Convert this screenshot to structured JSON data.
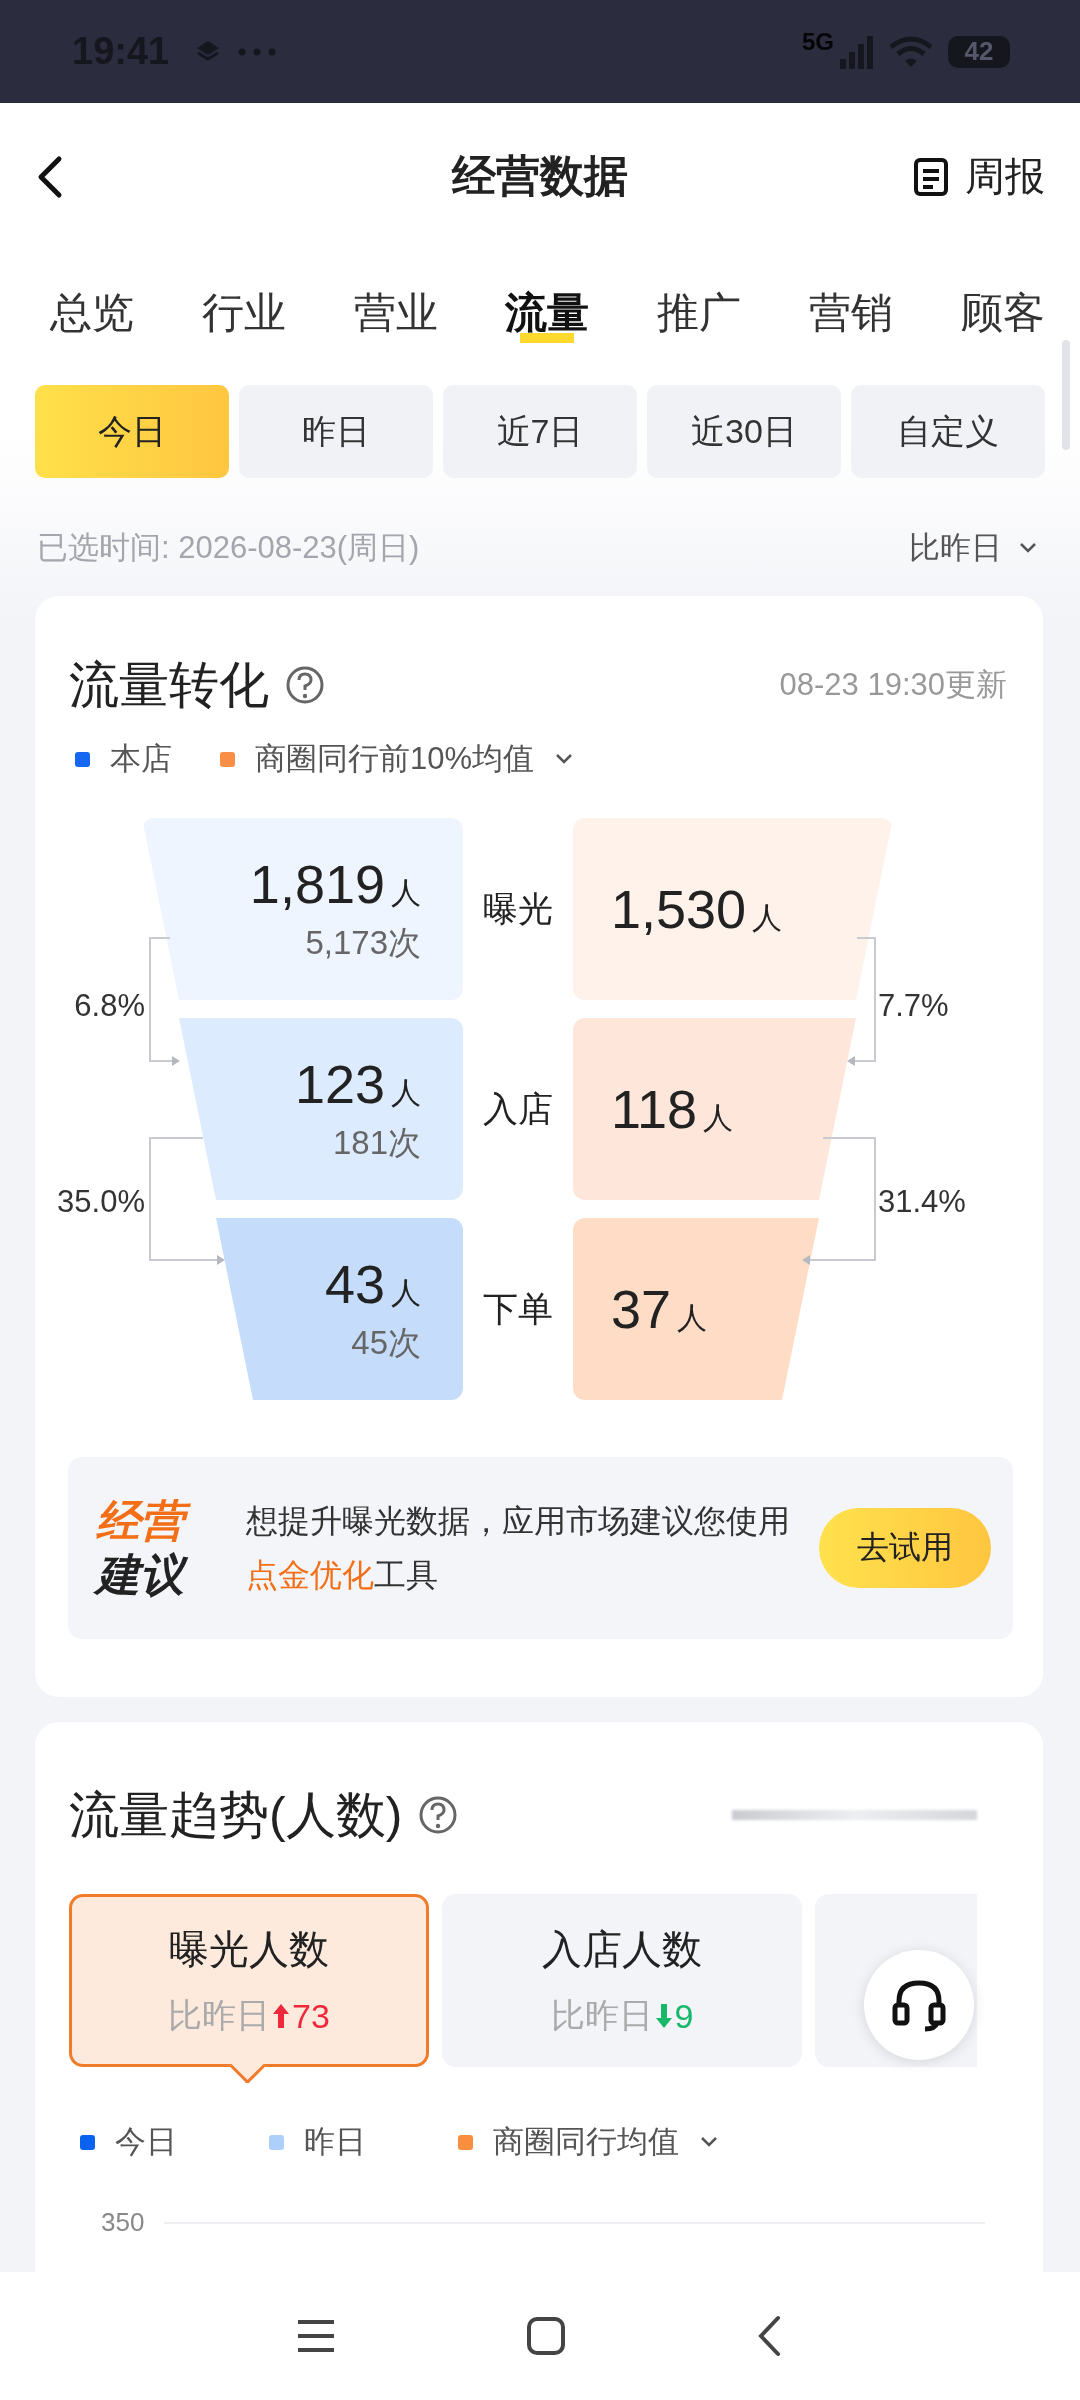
{
  "status_bar": {
    "time": "19:41",
    "network": "5G",
    "battery": "42"
  },
  "header": {
    "title": "经营数据",
    "action": "周报"
  },
  "tabs": [
    {
      "label": "总览",
      "selected": false
    },
    {
      "label": "行业",
      "selected": false
    },
    {
      "label": "营业",
      "selected": false
    },
    {
      "label": "流量",
      "selected": true
    },
    {
      "label": "推广",
      "selected": false
    },
    {
      "label": "营销",
      "selected": false
    },
    {
      "label": "顾客",
      "selected": false
    }
  ],
  "date_ranges": [
    {
      "label": "今日",
      "selected": true
    },
    {
      "label": "昨日",
      "selected": false
    },
    {
      "label": "近7日",
      "selected": false
    },
    {
      "label": "近30日",
      "selected": false
    },
    {
      "label": "自定义",
      "selected": false
    }
  ],
  "selected_time": "已选时间: 2026-08-23(周日)",
  "compare": "比昨日",
  "conversion": {
    "title": "流量转化",
    "updated": "08-23 19:30更新",
    "legend": [
      {
        "label": "本店",
        "color": "#1668f0",
        "dropdown": false
      },
      {
        "label": "商圈同行前10%均值",
        "color": "#f98e47",
        "dropdown": true
      }
    ],
    "stages": [
      {
        "label": "曝光",
        "store": {
          "people": "1,819",
          "unit": "人",
          "visits": "5,173次"
        },
        "peer": {
          "people": "1,530",
          "unit": "人"
        }
      },
      {
        "label": "入店",
        "store": {
          "people": "123",
          "unit": "人",
          "visits": "181次"
        },
        "peer": {
          "people": "118",
          "unit": "人"
        }
      },
      {
        "label": "下单",
        "store": {
          "people": "43",
          "unit": "人",
          "visits": "45次"
        },
        "peer": {
          "people": "37",
          "unit": "人"
        }
      }
    ],
    "store_rates": [
      "6.8%",
      "35.0%"
    ],
    "peer_rates": [
      "7.7%",
      "31.4%"
    ],
    "tip": {
      "badge_top": "经营",
      "badge_bottom": "建议",
      "message": [
        {
          "text": "想提升曝光数据，应用市场建议您使用",
          "highlight": false
        },
        {
          "text": "点金优化",
          "highlight": true
        },
        {
          "text": "工具",
          "highlight": false
        }
      ],
      "button": "去试用"
    }
  },
  "trend": {
    "title": "流量趋势(人数)",
    "metrics": [
      {
        "title": "曝光人数",
        "compare": "比昨日",
        "increase": true,
        "delta": "73",
        "selected": true
      },
      {
        "title": "入店人数",
        "compare": "比昨日",
        "increase": false,
        "delta": "9",
        "selected": false
      },
      {
        "selected": false
      }
    ],
    "legend": [
      {
        "label": "今日",
        "color": "#0a63f0",
        "dropdown": false
      },
      {
        "label": "昨日",
        "color": "#acd0fb",
        "dropdown": false
      },
      {
        "label": "商圈同行均值",
        "color": "#f98e3f",
        "dropdown": true
      }
    ],
    "y_top_label": "350"
  }
}
